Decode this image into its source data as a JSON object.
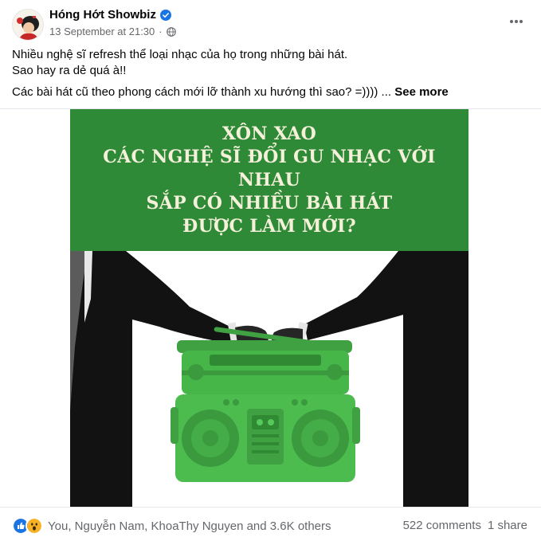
{
  "post": {
    "page_name": "Hóng Hớt Showbiz",
    "timestamp": "13 September at 21:30",
    "separator": "·",
    "lines": [
      "Nhiều nghệ sĩ refresh thể loại nhạc của họ trong những bài hát.",
      "Sao hay ra dẻ quá à!!",
      "Các bài hát cũ theo phong cách mới lỡ thành xu hướng thì sao? =)))) ..."
    ],
    "see_more": "See more"
  },
  "image": {
    "headline": [
      "XÔN XAO",
      "CÁC NGHỆ SĨ ĐỔI GU NHẠC VỚI NHAU",
      "SẮP CÓ NHIỀU BÀI HÁT",
      "ĐƯỢC LÀM MỚI?"
    ],
    "colors": {
      "banner": "#2f8a37",
      "radio": "#43b246",
      "suit": "#111111"
    }
  },
  "footer": {
    "reactions_text": "You, Nguyễn Nam, KhoaThy Nguyen and 3.6K others",
    "comments": "522 comments",
    "shares": "1 share",
    "reaction_icons": [
      "like-icon",
      "wow-icon"
    ]
  },
  "colors": {
    "verified": "#1b74e4",
    "secondary_text": "#65676b"
  }
}
